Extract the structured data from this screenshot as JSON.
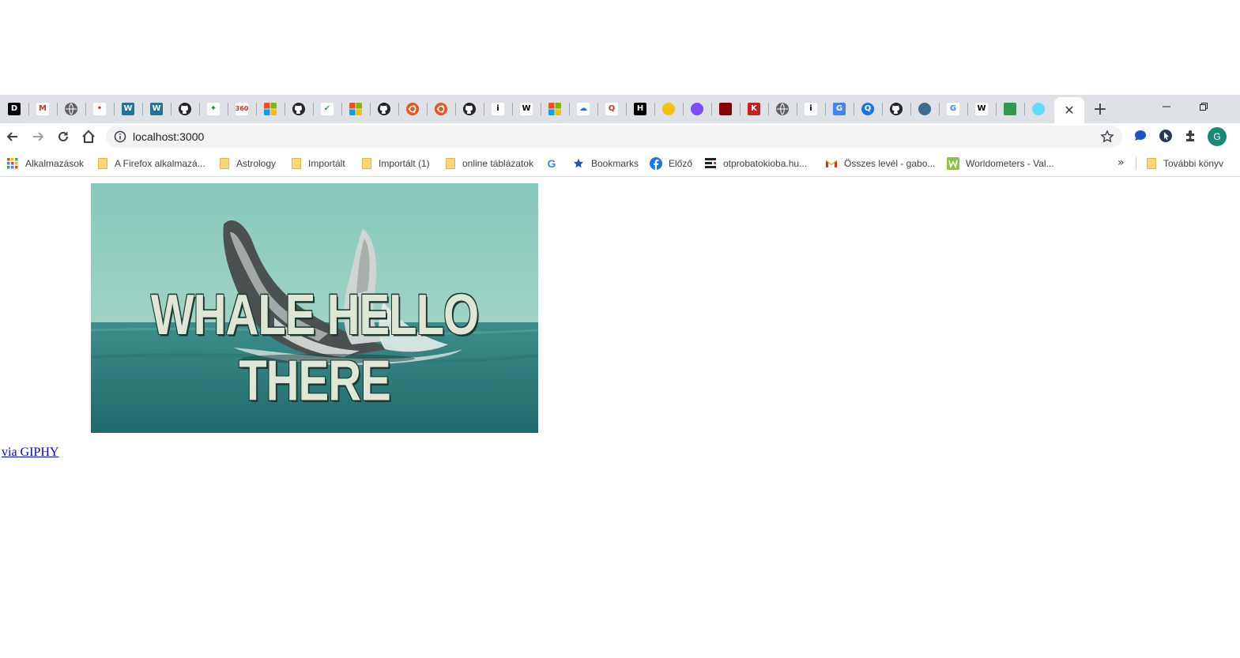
{
  "browser": {
    "tabs": [
      {
        "icon": "dev-icon",
        "glyph": "D",
        "bg": "#000000"
      },
      {
        "icon": "gmail-icon",
        "glyph": "M",
        "bg": "#ffffff",
        "fg": "#d93025"
      },
      {
        "icon": "globe-icon",
        "glyph": "",
        "bg": "#5f6368"
      },
      {
        "icon": "dot-icon",
        "glyph": "•",
        "bg": "#ffffff",
        "fg": "#d93025"
      },
      {
        "icon": "wordpress-icon",
        "glyph": "W",
        "bg": "#21759b"
      },
      {
        "icon": "wordpress-icon",
        "glyph": "W",
        "bg": "#21759b"
      },
      {
        "icon": "github-icon",
        "glyph": "",
        "bg": "#24292e"
      },
      {
        "icon": "leaf-icon",
        "glyph": "✦",
        "bg": "#ffffff",
        "fg": "#1e8e3e"
      },
      {
        "icon": "360-icon",
        "glyph": "360",
        "bg": "#ffffff",
        "fg": "#d93025"
      },
      {
        "icon": "microsoft-icon",
        "glyph": "",
        "bg": "ms"
      },
      {
        "icon": "github-icon",
        "glyph": "",
        "bg": "#24292e"
      },
      {
        "icon": "leaf-green-icon",
        "glyph": "✔",
        "bg": "#ffffff",
        "fg": "#34a853"
      },
      {
        "icon": "microsoft-icon",
        "glyph": "",
        "bg": "ms"
      },
      {
        "icon": "github-icon",
        "glyph": "",
        "bg": "#24292e"
      },
      {
        "icon": "ubuntu-icon",
        "glyph": "",
        "bg": "#e95420"
      },
      {
        "icon": "ubuntu-icon",
        "glyph": "",
        "bg": "#e95420"
      },
      {
        "icon": "github-icon",
        "glyph": "",
        "bg": "#24292e"
      },
      {
        "icon": "info-bar-icon",
        "glyph": "i",
        "bg": "#ffffff",
        "fg": "#000000"
      },
      {
        "icon": "wikipedia-icon",
        "glyph": "W",
        "bg": "#ffffff",
        "fg": "#000000"
      },
      {
        "icon": "microsoft-icon",
        "glyph": "",
        "bg": "ms"
      },
      {
        "icon": "cloud-icon",
        "glyph": "☁",
        "bg": "#ffffff",
        "fg": "#1a73e8"
      },
      {
        "icon": "quora-icon",
        "glyph": "Q",
        "bg": "#ffffff",
        "fg": "#d93025"
      },
      {
        "icon": "hn-icon",
        "glyph": "H",
        "bg": "#000000"
      },
      {
        "icon": "circle-yellow-icon",
        "glyph": "",
        "bg": "#f4c20d"
      },
      {
        "icon": "messenger-icon",
        "glyph": "",
        "bg": "#7b4dff"
      },
      {
        "icon": "red-box-icon",
        "glyph": "",
        "bg": "#8b0000"
      },
      {
        "icon": "k-icon",
        "glyph": "K",
        "bg": "#c5221f"
      },
      {
        "icon": "globe-icon",
        "glyph": "",
        "bg": "#5f6368"
      },
      {
        "icon": "info-bar-icon",
        "glyph": "i",
        "bg": "#ffffff",
        "fg": "#000000"
      },
      {
        "icon": "translate-icon",
        "glyph": "G",
        "bg": "#4285f4"
      },
      {
        "icon": "search-q-icon",
        "glyph": "Q",
        "bg": "#1a73e8"
      },
      {
        "icon": "github-icon",
        "glyph": "",
        "bg": "#24292e"
      },
      {
        "icon": "eye-icon",
        "glyph": "",
        "bg": "#3c6e8f"
      },
      {
        "icon": "google-icon",
        "glyph": "G",
        "bg": "#ffffff",
        "fg": "#4285f4"
      },
      {
        "icon": "wikipedia-icon",
        "glyph": "W",
        "bg": "#ffffff",
        "fg": "#000000"
      },
      {
        "icon": "hexagon-icon",
        "glyph": "",
        "bg": "#2e9b4e"
      },
      {
        "icon": "react-icon",
        "glyph": "",
        "bg": "#61dafb"
      }
    ],
    "active_tab_close": "✕",
    "new_tab": "+",
    "url": "localhost:3000",
    "bookmarks": [
      {
        "icon": "apps-icon",
        "label": "Alkalmazások"
      },
      {
        "icon": "folder-icon",
        "label": "A Firefox alkalmazá..."
      },
      {
        "icon": "folder-icon",
        "label": "Astrology"
      },
      {
        "icon": "folder-icon",
        "label": "Importált"
      },
      {
        "icon": "folder-icon",
        "label": "Importált (1)"
      },
      {
        "icon": "folder-icon",
        "label": "online táblázatok"
      },
      {
        "icon": "google-icon",
        "label": ""
      },
      {
        "icon": "star-icon",
        "label": "Bookmarks"
      },
      {
        "icon": "facebook-icon",
        "label": "Előző"
      },
      {
        "icon": "otp-icon",
        "label": "otprobatokioba.hu..."
      },
      {
        "icon": "gmail-icon",
        "label": "Összes levél - gabo..."
      },
      {
        "icon": "worldometers-icon",
        "label": "Worldometers - Val..."
      }
    ],
    "more_bookmarks": "»",
    "other_bookmarks": "További könyv",
    "profile_initial": "G"
  },
  "page": {
    "gif_caption": "WHALE HELLO THERE",
    "gif_colors": {
      "sky": "#86c9bb",
      "sea": "#2e7d7b",
      "whale": "#4a5150"
    },
    "giphy_link": "via GIPHY"
  }
}
